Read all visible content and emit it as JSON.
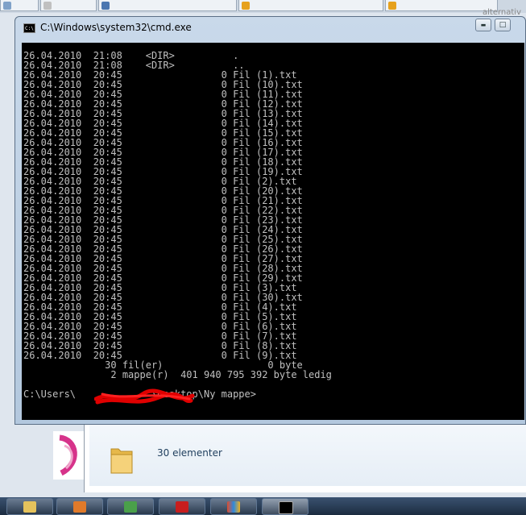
{
  "window": {
    "title": "C:\\Windows\\system32\\cmd.exe",
    "minimize_glyph": "▬",
    "maximize_glyph": "□",
    "close_glyph": "✕"
  },
  "console": {
    "lines": [
      "26.04.2010  21:08    <DIR>          .",
      "26.04.2010  21:08    <DIR>          ..",
      "26.04.2010  20:45                 0 Fil (1).txt",
      "26.04.2010  20:45                 0 Fil (10).txt",
      "26.04.2010  20:45                 0 Fil (11).txt",
      "26.04.2010  20:45                 0 Fil (12).txt",
      "26.04.2010  20:45                 0 Fil (13).txt",
      "26.04.2010  20:45                 0 Fil (14).txt",
      "26.04.2010  20:45                 0 Fil (15).txt",
      "26.04.2010  20:45                 0 Fil (16).txt",
      "26.04.2010  20:45                 0 Fil (17).txt",
      "26.04.2010  20:45                 0 Fil (18).txt",
      "26.04.2010  20:45                 0 Fil (19).txt",
      "26.04.2010  20:45                 0 Fil (2).txt",
      "26.04.2010  20:45                 0 Fil (20).txt",
      "26.04.2010  20:45                 0 Fil (21).txt",
      "26.04.2010  20:45                 0 Fil (22).txt",
      "26.04.2010  20:45                 0 Fil (23).txt",
      "26.04.2010  20:45                 0 Fil (24).txt",
      "26.04.2010  20:45                 0 Fil (25).txt",
      "26.04.2010  20:45                 0 Fil (26).txt",
      "26.04.2010  20:45                 0 Fil (27).txt",
      "26.04.2010  20:45                 0 Fil (28).txt",
      "26.04.2010  20:45                 0 Fil (29).txt",
      "26.04.2010  20:45                 0 Fil (3).txt",
      "26.04.2010  20:45                 0 Fil (30).txt",
      "26.04.2010  20:45                 0 Fil (4).txt",
      "26.04.2010  20:45                 0 Fil (5).txt",
      "26.04.2010  20:45                 0 Fil (6).txt",
      "26.04.2010  20:45                 0 Fil (7).txt",
      "26.04.2010  20:45                 0 Fil (8).txt",
      "26.04.2010  20:45                 0 Fil (9).txt",
      "              30 fil(er)                  0 byte",
      "               2 mappe(r)  401 940 795 392 byte ledig",
      "",
      "C:\\Users\\             \\Desktop\\Ny mappe>"
    ]
  },
  "explorer": {
    "status_text": "30 elementer"
  },
  "background": {
    "right_text": "alternativ"
  },
  "colors": {
    "console_bg": "#000000",
    "console_fg": "#c0c0c0",
    "redaction": "#e00000"
  }
}
